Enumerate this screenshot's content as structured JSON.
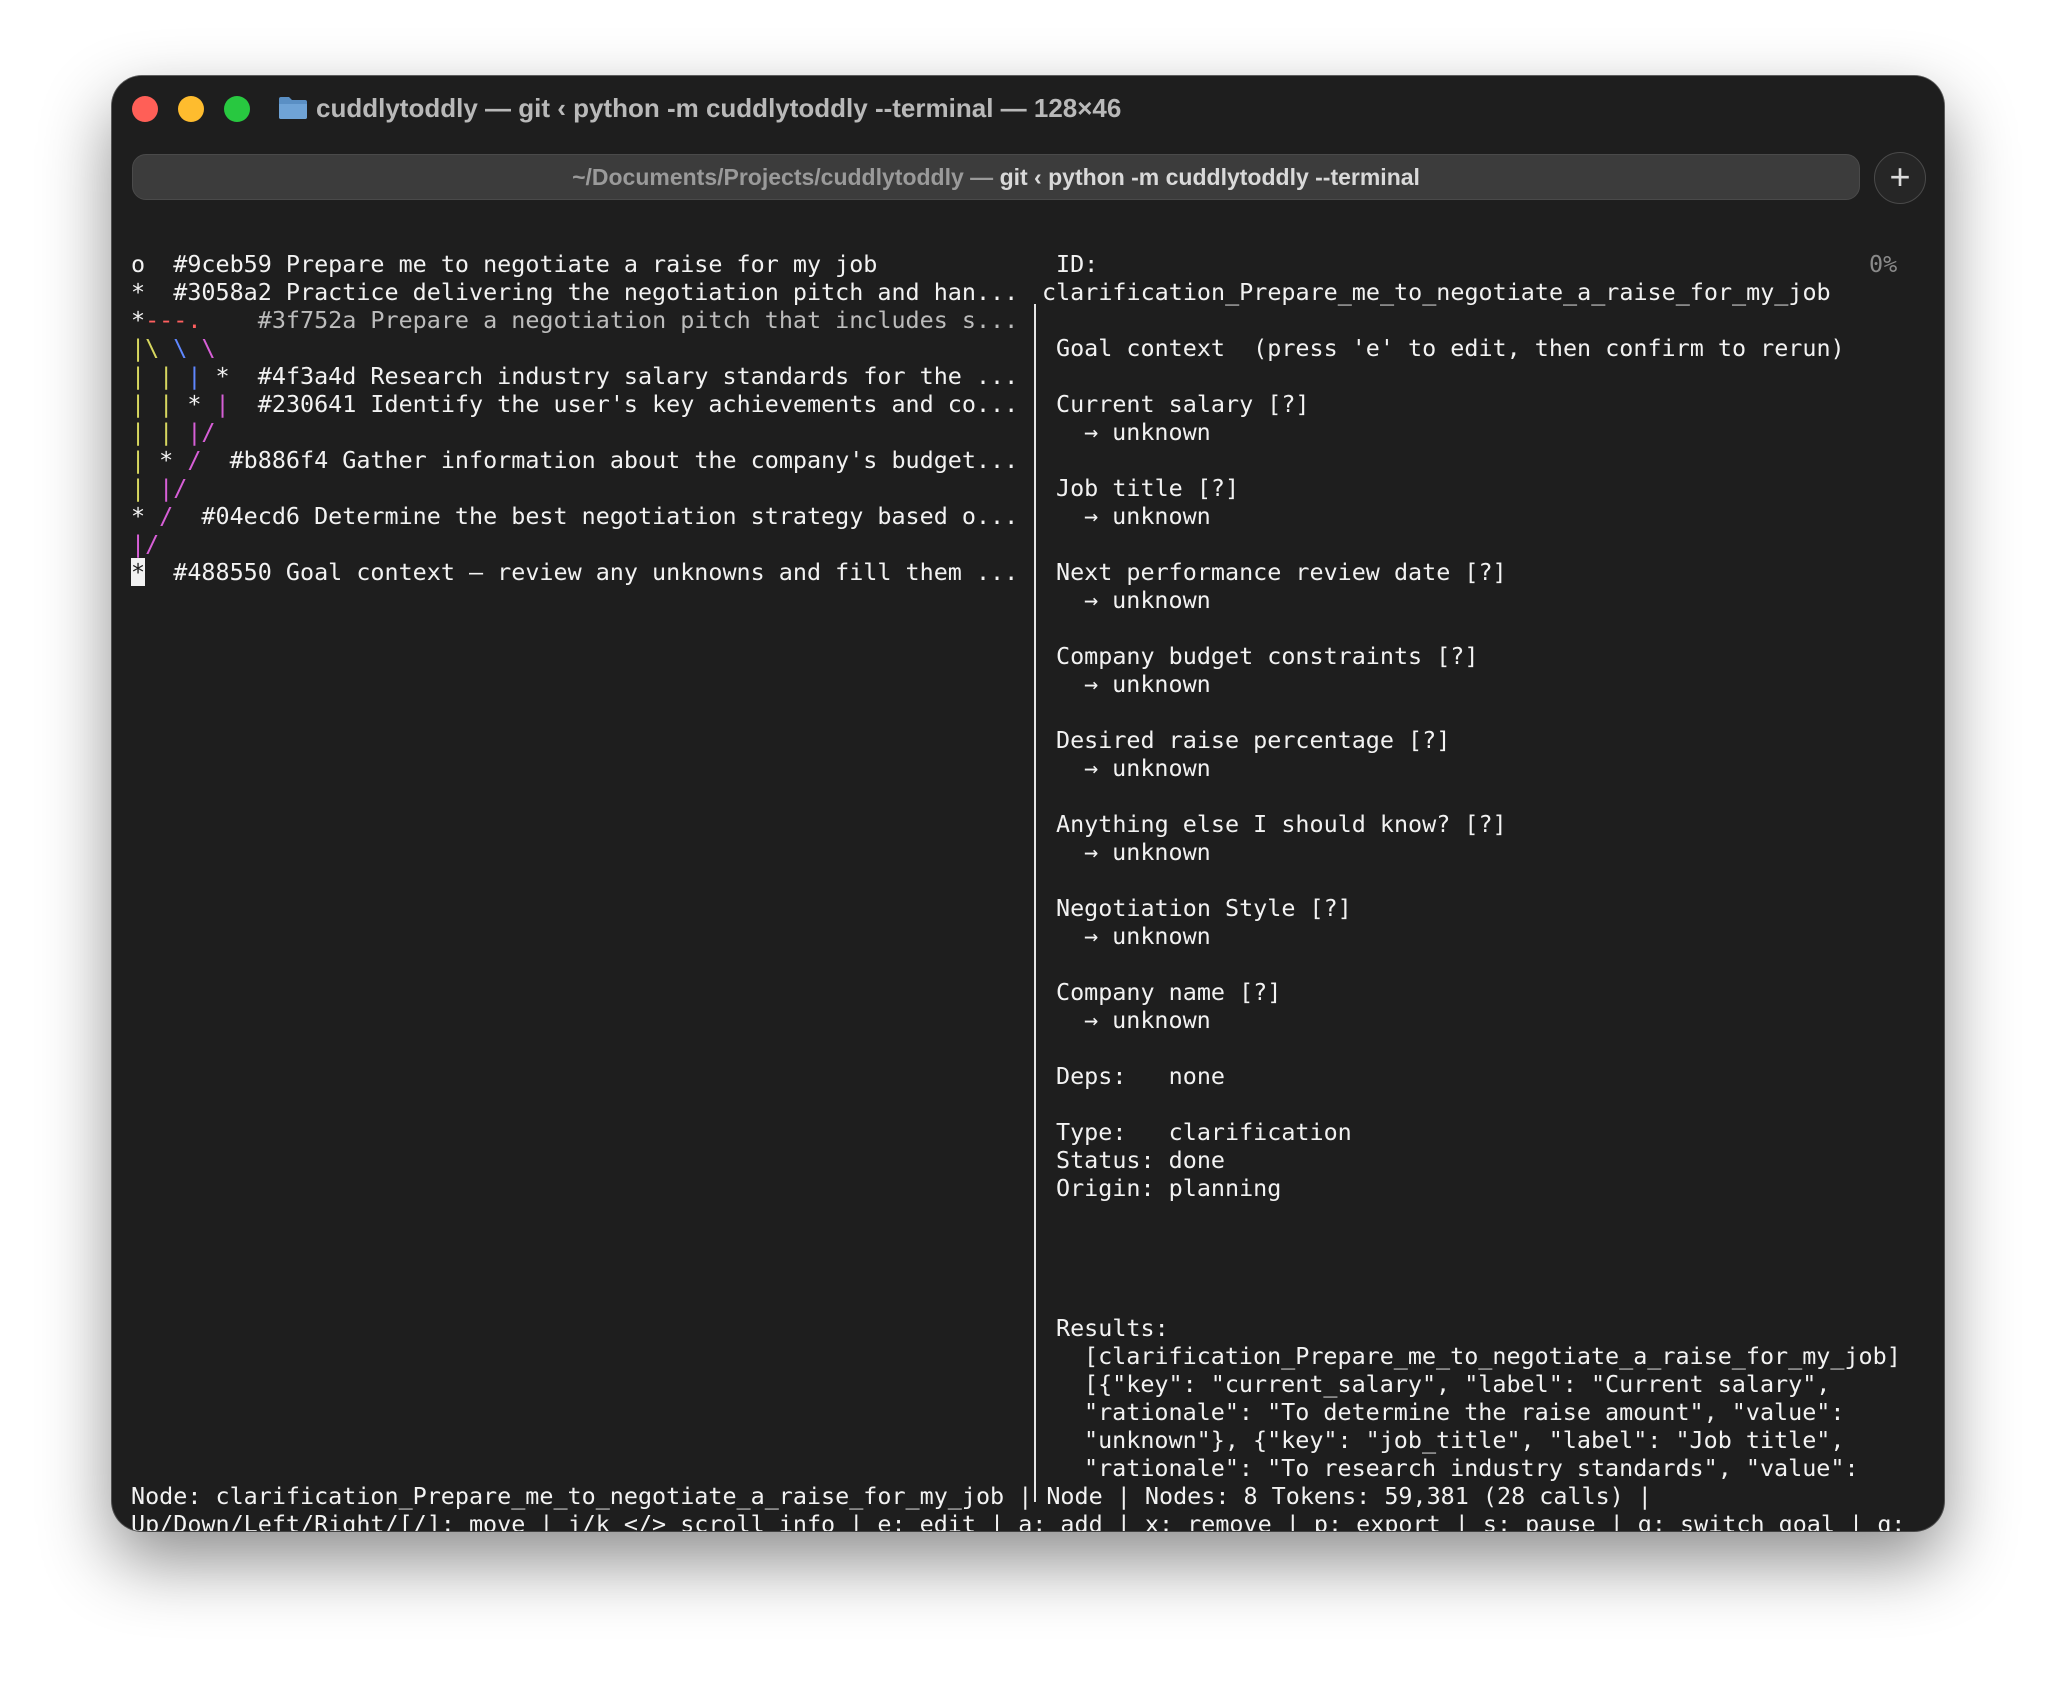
{
  "window": {
    "title": "cuddlytoddly — git ‹ python -m cuddlytoddly --terminal — 128×46",
    "tab_title_path": "~/Documents/Projects/cuddlytoddly — ",
    "tab_title_cmd": "git ‹ python -m cuddlytoddly --terminal"
  },
  "graph": {
    "rows": [
      {
        "mark": "o",
        "text": "  #9ceb59 Prepare me to negotiate a raise for my job"
      },
      {
        "mark": "*",
        "text": "  #3058a2 Practice delivering the negotiation pitch and han..."
      },
      {
        "mark": "*",
        "lines": "---.",
        "text": "    #3f752a Prepare a negotiation pitch that includes s..."
      },
      {
        "lines": "|\\ \\ \\"
      },
      {
        "lines": "| | | ",
        "mark": "*",
        "text": "  #4f3a4d Research industry salary standards for the ..."
      },
      {
        "lines": "| | ",
        "mark": "*",
        "lines2": " |",
        "text": "  #230641 Identify the user's key achievements and co..."
      },
      {
        "lines": "| | |/"
      },
      {
        "lines": "| ",
        "mark": "*",
        "lines2": " /",
        "text": "  #b886f4 Gather information about the company's budget..."
      },
      {
        "lines": "| |/"
      },
      {
        "mark": "*",
        "lines2": " /",
        "text": "  #04ecd6 Determine the best negotiation strategy based o..."
      },
      {
        "lines": "|/"
      },
      {
        "mark": "*",
        "text": "  #488550 Goal context — review any unknowns and fill them ..."
      }
    ]
  },
  "detail": {
    "scroll_pct": "0%",
    "id_label": "ID:",
    "id_value": "clarification_Prepare_me_to_negotiate_a_raise_for_my_job",
    "goal_context_header": "Goal context  (press 'e' to edit, then confirm to rerun)",
    "fields": [
      {
        "label": "Current salary [?]",
        "value": "→ unknown"
      },
      {
        "label": "Job title [?]",
        "value": "→ unknown"
      },
      {
        "label": "Next performance review date [?]",
        "value": "→ unknown"
      },
      {
        "label": "Company budget constraints [?]",
        "value": "→ unknown"
      },
      {
        "label": "Desired raise percentage [?]",
        "value": "→ unknown"
      },
      {
        "label": "Anything else I should know? [?]",
        "value": "→ unknown"
      },
      {
        "label": "Negotiation Style [?]",
        "value": "→ unknown"
      },
      {
        "label": "Company name [?]",
        "value": "→ unknown"
      }
    ],
    "deps": "Deps:   none",
    "type": "Type:   clarification",
    "status": "Status: done",
    "origin": "Origin: planning",
    "results_label": "Results:",
    "results_lines": [
      "[clarification_Prepare_me_to_negotiate_a_raise_for_my_job]",
      "[{\"key\": \"current_salary\", \"label\": \"Current salary\",",
      "\"rationale\": \"To determine the raise amount\", \"value\":",
      "\"unknown\"}, {\"key\": \"job_title\", \"label\": \"Job title\",",
      "\"rationale\": \"To research industry standards\", \"value\":"
    ]
  },
  "statusbar": {
    "line1": "Node: clarification_Prepare_me_to_negotiate_a_raise_for_my_job | Node | Nodes: 8 Tokens: 59,381 (28 calls) |",
    "line2": "Up/Down/Left/Right/[/]: move | j/k </> scroll info | e: edit | a: add | x: remove | p: export | s: pause | g: switch goal | q:"
  },
  "colors": {
    "traffic_red": "#ff5f57",
    "traffic_yellow": "#febc2e",
    "traffic_green": "#28c840",
    "graph_yellow": "#d7d75f",
    "graph_blue": "#5f87ff",
    "graph_magenta": "#d75fd7",
    "graph_red": "#ff5f5f"
  }
}
